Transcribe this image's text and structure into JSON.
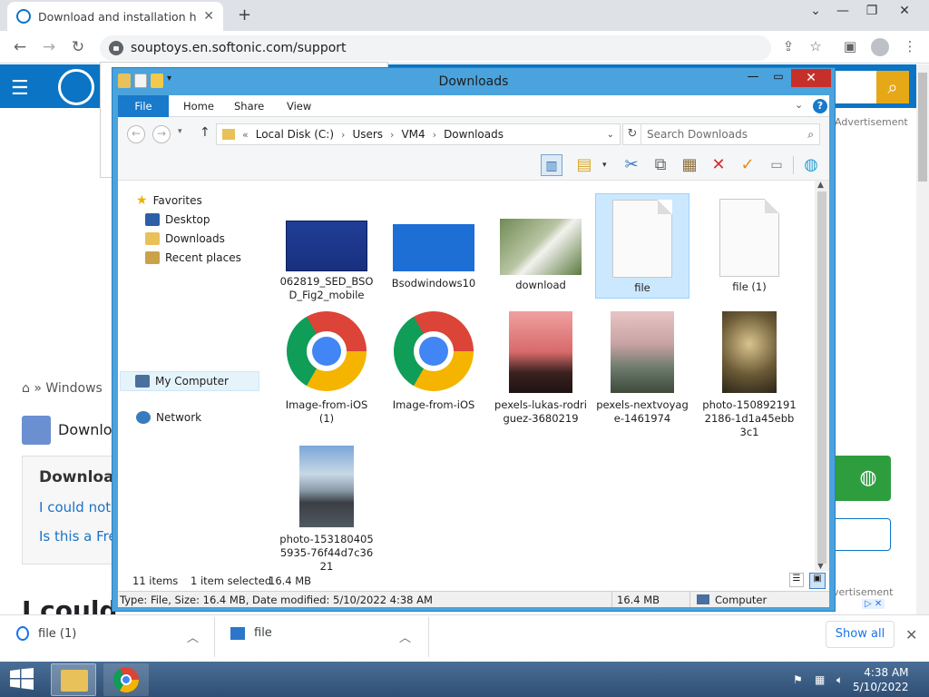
{
  "browser": {
    "tab_title": "Download and installation help",
    "url": "souptoys.en.softonic.com/support",
    "close_tab": "✕",
    "new_tab": "+"
  },
  "page": {
    "advertisement": "Advertisement",
    "advertisement_bottom": "vertisement",
    "breadcrumb": "» Windows",
    "app_title": "Downloa",
    "question_title": "Downloa",
    "question_line1": "I could not",
    "question_line2": "Is this a Fre",
    "bottom_heading": "I could",
    "ad_badge": "▷ ✕"
  },
  "explorer": {
    "title": "Downloads",
    "ribbon_tabs": [
      "File",
      "Home",
      "Share",
      "View"
    ],
    "help": "?",
    "breadcrumb": [
      "«",
      "Local Disk (C:)",
      "Users",
      "VM4",
      "Downloads"
    ],
    "search_placeholder": "Search Downloads",
    "nav": {
      "favorites": "Favorites",
      "desktop": "Desktop",
      "downloads": "Downloads",
      "recent": "Recent places",
      "my_computer": "My Computer",
      "network": "Network"
    },
    "files": [
      {
        "name": "062819_SED_BSOD_Fig2_mobile",
        "kind": "bsod1"
      },
      {
        "name": "Bsodwindows10",
        "kind": "bsod2"
      },
      {
        "name": "download",
        "kind": "photo-girl"
      },
      {
        "name": "file",
        "kind": "doc",
        "selected": true
      },
      {
        "name": "file (1)",
        "kind": "doc"
      },
      {
        "name": "Image-from-iOS (1)",
        "kind": "chrome"
      },
      {
        "name": "Image-from-iOS",
        "kind": "chrome"
      },
      {
        "name": "pexels-lukas-rodriguez-3680219",
        "kind": "photo-tree"
      },
      {
        "name": "pexels-nextvoyage-1461974",
        "kind": "photo-eiffel"
      },
      {
        "name": "photo-1508921912186-1d1a45ebb3c1",
        "kind": "photo-forest"
      },
      {
        "name": "photo-1531804055935-76f44d7c3621",
        "kind": "photo-road"
      }
    ],
    "status": {
      "items": "11 items",
      "selected": "1 item selected",
      "size": "16.4 MB"
    },
    "details": {
      "info": "Type: File, Size: 16.4 MB, Date modified: 5/10/2022 4:38 AM",
      "size": "16.4 MB",
      "location": "Computer"
    }
  },
  "shelf": {
    "item1": "file (1)",
    "item2": "file",
    "show_all": "Show all"
  },
  "taskbar": {
    "time": "4:38 AM",
    "date": "5/10/2022"
  }
}
